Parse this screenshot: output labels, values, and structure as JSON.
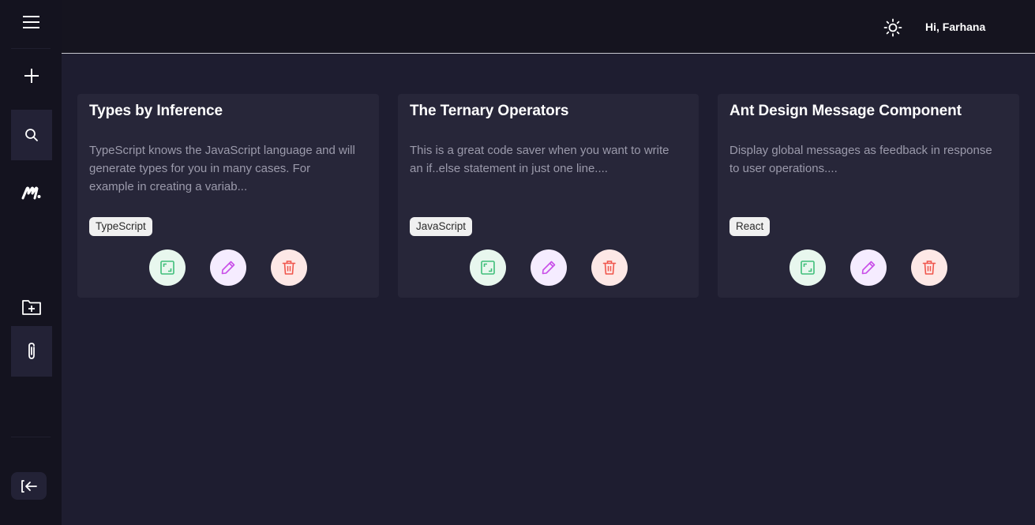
{
  "header": {
    "greeting": "Hi, Farhana"
  },
  "sidebar": {
    "icons": [
      "menu-icon",
      "plus-icon",
      "search-icon",
      "logo-icon",
      "folder-plus-icon",
      "paperclip-icon",
      "logout-icon"
    ]
  },
  "cards": [
    {
      "title": "Types by Inference",
      "description": "TypeScript knows the JavaScript language and will generate types for you in many cases. For example in creating a variab...",
      "tag": "TypeScript"
    },
    {
      "title": "The Ternary Operators",
      "description": "This is a great code saver when you want to write an if..else statement in just one line....",
      "tag": "JavaScript"
    },
    {
      "title": "Ant Design Message Component",
      "description": "Display global messages as feedback in response to user operations....",
      "tag": "React"
    }
  ],
  "colors": {
    "background": "#1e1d30",
    "sidebar": "#14131f",
    "card": "#272639",
    "view_icon": "#3fbf7a",
    "edit_icon": "#c94ee8",
    "delete_icon": "#f0554b"
  }
}
